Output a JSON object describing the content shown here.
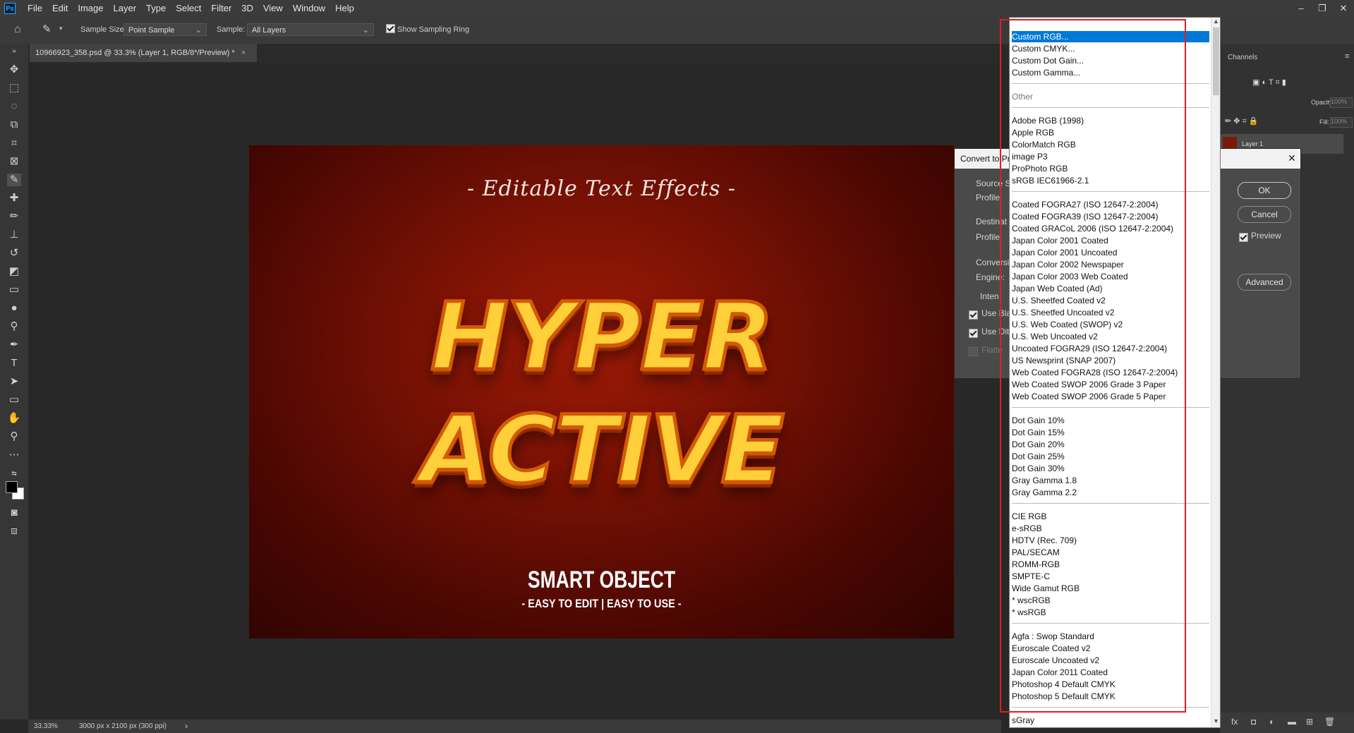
{
  "app": {
    "icon_label": "Ps"
  },
  "menu": [
    "File",
    "Edit",
    "Image",
    "Layer",
    "Type",
    "Select",
    "Filter",
    "3D",
    "View",
    "Window",
    "Help"
  ],
  "window_controls": [
    "–",
    "❐",
    "✕"
  ],
  "options_bar": {
    "sample_size_label": "Sample Size:",
    "sample_size_value": "Point Sample",
    "sample_label": "Sample:",
    "sample_value": "All Layers",
    "show_ring_label": "Show Sampling Ring",
    "show_ring_checked": true
  },
  "document_tab": {
    "title": "10966923_358.psd @ 33.3% (Layer 1, RGB/8*/Preview) *",
    "close": "×"
  },
  "artwork": {
    "script_text": "- Editable Text Effects -",
    "line1": "HYPER",
    "line2": "ACTIVE",
    "smart_title": "SMART OBJECT",
    "smart_sub": "- EASY TO EDIT | EASY TO USE -"
  },
  "status": {
    "zoom": "33.33%",
    "doc_info": "3000 px x 2100 px (300 ppi)",
    "arrow": "›"
  },
  "panels": {
    "channels_tab": "Channels",
    "opacity_label": "Opacity:",
    "opacity_value": "100%",
    "fill_label": "Fill:",
    "fill_value": "100%",
    "layer_name": "Layer 1"
  },
  "dialog": {
    "title": "Convert to Pr",
    "close": "✕",
    "source_label": "Source S",
    "profile1_label": "Profile:",
    "destination_label": "Destinat",
    "profile2_label": "Profile:",
    "conversion_label": "Conversi",
    "engine_label": "Engine:",
    "intent_label": "Inten",
    "use_black_label": "Use Bla",
    "use_dither_label": "Use Dit",
    "flatten_label": "Flatte",
    "ok": "OK",
    "cancel": "Cancel",
    "preview_label": "Preview",
    "advanced": "Advanced"
  },
  "profile_dropdown": {
    "custom": [
      "Custom RGB...",
      "Custom CMYK...",
      "Custom Dot Gain...",
      "Custom Gamma..."
    ],
    "other_header": "Other",
    "rgb": [
      "Adobe RGB (1998)",
      "Apple RGB",
      "ColorMatch RGB",
      "image P3",
      "ProPhoto RGB",
      "sRGB IEC61966-2.1"
    ],
    "cmyk": [
      "Coated FOGRA27 (ISO 12647-2:2004)",
      "Coated FOGRA39 (ISO 12647-2:2004)",
      "Coated GRACoL 2006 (ISO 12647-2:2004)",
      "Japan Color 2001 Coated",
      "Japan Color 2001 Uncoated",
      "Japan Color 2002 Newspaper",
      "Japan Color 2003 Web Coated",
      "Japan Web Coated (Ad)",
      "U.S. Sheetfed Coated v2",
      "U.S. Sheetfed Uncoated v2",
      "U.S. Web Coated (SWOP) v2",
      "U.S. Web Uncoated v2",
      "Uncoated FOGRA29 (ISO 12647-2:2004)",
      "US Newsprint (SNAP 2007)",
      "Web Coated FOGRA28 (ISO 12647-2:2004)",
      "Web Coated SWOP 2006 Grade 3 Paper",
      "Web Coated SWOP 2006 Grade 5 Paper"
    ],
    "gray": [
      "Dot Gain 10%",
      "Dot Gain 15%",
      "Dot Gain 20%",
      "Dot Gain 25%",
      "Dot Gain 30%",
      "Gray Gamma 1.8",
      "Gray Gamma 2.2"
    ],
    "rgb2": [
      "CIE RGB",
      "e-sRGB",
      "HDTV (Rec. 709)",
      "PAL/SECAM",
      "ROMM-RGB",
      "SMPTE-C",
      "Wide Gamut RGB",
      "* wscRGB",
      "* wsRGB"
    ],
    "cmyk2": [
      "Agfa : Swop Standard",
      "Euroscale Coated v2",
      "Euroscale Uncoated v2",
      "Japan Color 2011 Coated",
      "Photoshop 4 Default CMYK",
      "Photoshop 5 Default CMYK"
    ],
    "bottom_item": "sGray",
    "highlight_color": "#e31b23"
  }
}
